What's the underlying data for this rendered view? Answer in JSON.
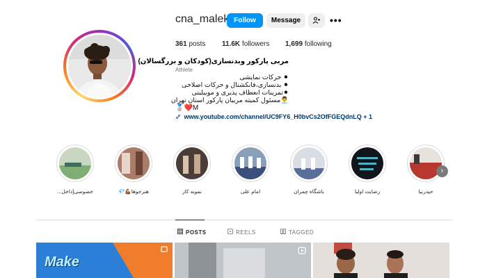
{
  "profile": {
    "username": "cna_maleki",
    "follow_label": "Follow",
    "message_label": "Message",
    "more_label": "•••"
  },
  "stats": {
    "posts_count": "361",
    "posts_label": "posts",
    "followers_count": "11.6K",
    "followers_label": "followers",
    "following_count": "1,699",
    "following_label": "following"
  },
  "bio": {
    "name": "مربی پارکور وبدنسازی(کودکان و بزرگسالان)",
    "category": "Athlete",
    "lines": [
      "⚫ حرکات نمایشی",
      "⚫ بدنسازی،فانکشنال و حرکات اصلاحی",
      "⚫تمرینات انعطاف پذیری و موبیلیتی",
      "👨‍💼مسئول کمیته مربیان پارکور استان تهران"
    ],
    "emoji_line": "🥈❤️M",
    "link_text": "www.youtube.com/channel/UC9FY6_H0bvCs2OfFGEQdnLQ + 1"
  },
  "highlights": [
    {
      "label": "خصوصی[داخل..."
    },
    {
      "label": "هنرجوها💪🏾💎"
    },
    {
      "label": "نمونه کار"
    },
    {
      "label": "امام علی"
    },
    {
      "label": "باشگاه چمران"
    },
    {
      "label": "رضایت اولیا"
    },
    {
      "label": "حیدرنیا"
    }
  ],
  "tabs": {
    "posts": "POSTS",
    "reels": "REELS",
    "tagged": "TAGGED"
  },
  "posts": [
    {
      "overlay_text": "Make"
    }
  ],
  "icons": {
    "add_user": "add-user-icon",
    "more": "more-options-icon",
    "link": "link-icon",
    "grid": "grid-icon",
    "reels": "reels-icon",
    "tagged": "tagged-icon",
    "next": "chevron-right-icon"
  },
  "colors": {
    "accent": "#0095f6",
    "link": "#00376b",
    "muted": "#737373",
    "divider": "#dbdbdb"
  }
}
